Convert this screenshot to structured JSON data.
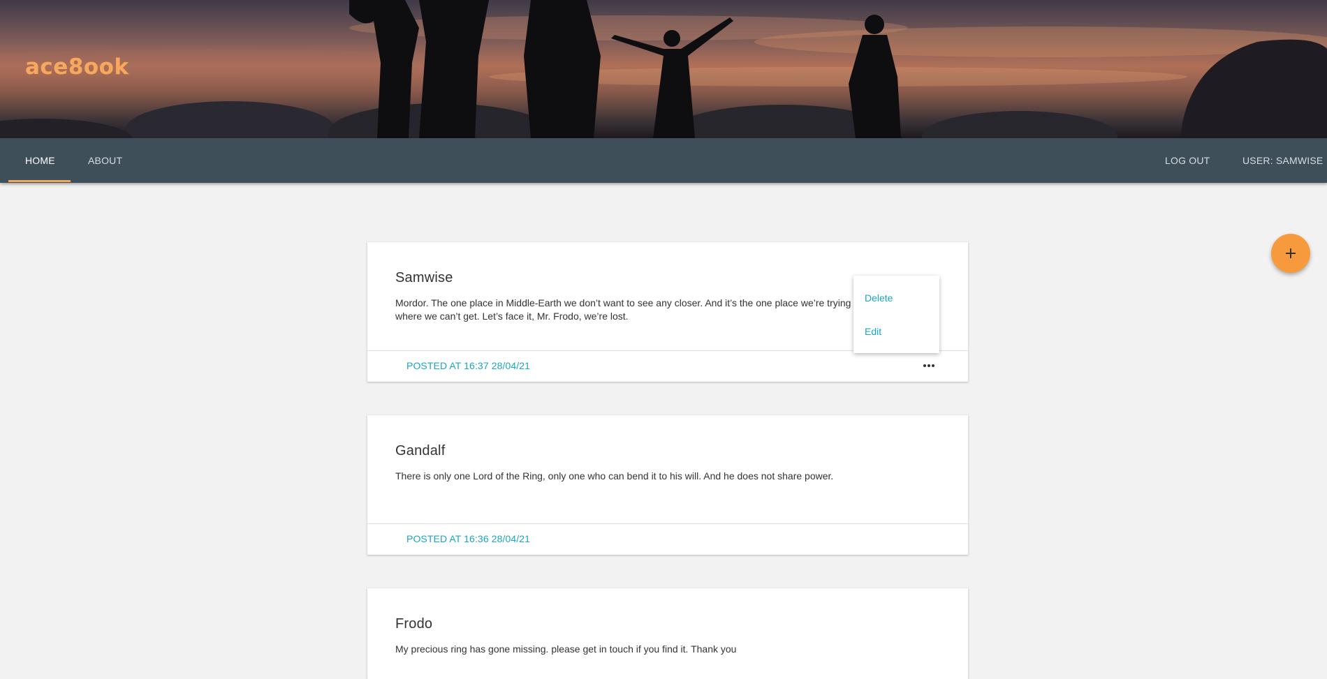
{
  "header": {
    "logo_text": "ace8ook"
  },
  "nav": {
    "home_label": "HOME",
    "about_label": "ABOUT",
    "logout_label": "LOG OUT",
    "user_label": "USER: SAMWISE"
  },
  "posts": [
    {
      "author": "Samwise",
      "body": "Mordor. The one place in Middle-Earth we don’t want to see any closer. And it’s the one place we’re trying to get to. It’s just where we can’t get. Let’s face it, Mr. Frodo, we’re lost.",
      "posted": "POSTED AT 16:37 28/04/21"
    },
    {
      "author": "Gandalf",
      "body": "There is only one Lord of the Ring, only one who can bend it to his will. And he does not share power.",
      "posted": "POSTED AT 16:36 28/04/21"
    },
    {
      "author": "Frodo",
      "body": "My precious ring has gone missing. please get in touch if you find it. Thank you",
      "posted": ""
    }
  ],
  "post_menu": {
    "delete_label": "Delete",
    "edit_label": "Edit"
  },
  "colors": {
    "accent_orange": "#f79a3e",
    "link_blue": "#19a5c6",
    "navbar": "#3e4f5a"
  },
  "icons": {
    "more": "more-horizontal-icon",
    "add": "plus-icon"
  }
}
